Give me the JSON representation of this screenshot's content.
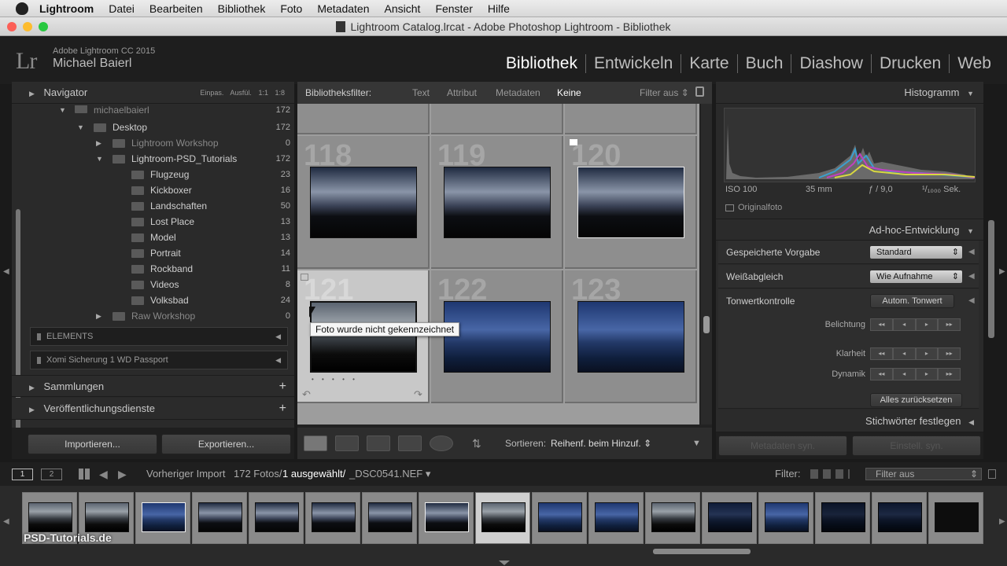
{
  "menubar": {
    "items": [
      "Lightroom",
      "Datei",
      "Bearbeiten",
      "Bibliothek",
      "Foto",
      "Metadaten",
      "Ansicht",
      "Fenster",
      "Hilfe"
    ]
  },
  "window": {
    "title": "Lightroom Catalog.lrcat - Adobe Photoshop Lightroom - Bibliothek"
  },
  "identity": {
    "logo": "Lr",
    "app": "Adobe Lightroom CC 2015",
    "user": "Michael Baierl"
  },
  "modules": [
    "Bibliothek",
    "Entwickeln",
    "Karte",
    "Buch",
    "Diashow",
    "Drucken",
    "Web"
  ],
  "navigator": {
    "title": "Navigator",
    "zoom": [
      "Einpas.",
      "Ausfül.",
      "1:1",
      "1:8"
    ]
  },
  "folders": {
    "parent": {
      "name": "michaelbaierl",
      "count": "172"
    },
    "desktop": {
      "name": "Desktop",
      "count": "172"
    },
    "items": [
      {
        "name": "Lightroom Workshop",
        "count": "0"
      },
      {
        "name": "Lightroom-PSD_Tutorials",
        "count": "172"
      },
      {
        "name": "Flugzeug",
        "count": "23"
      },
      {
        "name": "Kickboxer",
        "count": "16"
      },
      {
        "name": "Landschaften",
        "count": "50"
      },
      {
        "name": "Lost Place",
        "count": "13"
      },
      {
        "name": "Model",
        "count": "13"
      },
      {
        "name": "Portrait",
        "count": "14"
      },
      {
        "name": "Rockband",
        "count": "11"
      },
      {
        "name": "Videos",
        "count": "8"
      },
      {
        "name": "Volksbad",
        "count": "24"
      },
      {
        "name": "Raw Workshop",
        "count": "0"
      }
    ]
  },
  "volumes": [
    "ELEMENTS",
    "Xomi Sicherung 1 WD Passport"
  ],
  "left_sections": {
    "collections": "Sammlungen",
    "publish": "Veröffentlichungsdienste"
  },
  "left_buttons": {
    "import": "Importieren...",
    "export": "Exportieren..."
  },
  "filterbar": {
    "label": "Bibliotheksfilter:",
    "options": [
      "Text",
      "Attribut",
      "Metadaten",
      "Keine"
    ],
    "preset": "Filter aus"
  },
  "grid": {
    "numbers": [
      "118",
      "119",
      "120",
      "121",
      "122",
      "123"
    ]
  },
  "tooltip": "Foto wurde nicht gekennzeichnet",
  "toolbar": {
    "sort_label": "Sortieren:",
    "sort_value": "Reihenf. beim Hinzuf."
  },
  "histogram": {
    "title": "Histogramm",
    "iso": "ISO 100",
    "focal": "35 mm",
    "aperture": "ƒ / 9,0",
    "shutter": "¹/₁₀₀₀ Sek.",
    "original": "Originalfoto"
  },
  "quick_develop": {
    "title": "Ad-hoc-Entwicklung",
    "saved_preset_label": "Gespeicherte Vorgabe",
    "saved_preset_value": "Standard",
    "wb_label": "Weißabgleich",
    "wb_value": "Wie Aufnahme",
    "tone_label": "Tonwertkontrolle",
    "auto_tone": "Autom. Tonwert",
    "exposure": "Belichtung",
    "clarity": "Klarheit",
    "vibrance": "Dynamik",
    "reset": "Alles zurücksetzen"
  },
  "keywords_title": "Stichwörter festlegen",
  "sync": {
    "metadata": "Metadaten syn.",
    "settings": "Einstell. syn."
  },
  "filmstrip_head": {
    "source": "Vorheriger Import",
    "count": "172 Fotos/",
    "selected": "1 ausgewählt/",
    "file": "_DSC0541.NEF",
    "filter_label": "Filter:",
    "filter_value": "Filter aus"
  },
  "watermark": "PSD-Tutorials.de"
}
